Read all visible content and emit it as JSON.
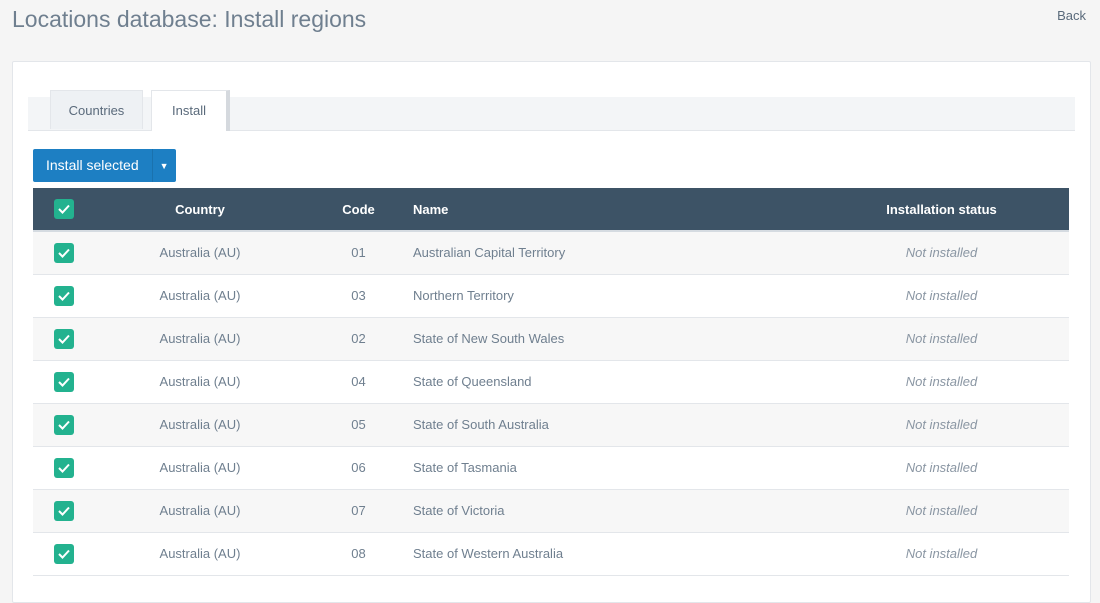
{
  "page": {
    "title": "Locations database: Install regions",
    "back_label": "Back"
  },
  "tabs": [
    {
      "label": "Countries",
      "active": false
    },
    {
      "label": "Install",
      "active": true
    }
  ],
  "toolbar": {
    "install_selected_label": "Install selected"
  },
  "table": {
    "columns": [
      "Country",
      "Code",
      "Name",
      "Installation status"
    ],
    "rows": [
      {
        "checked": true,
        "country": "Australia (AU)",
        "code": "01",
        "name": "Australian Capital Territory",
        "status": "Not installed"
      },
      {
        "checked": true,
        "country": "Australia (AU)",
        "code": "03",
        "name": "Northern Territory",
        "status": "Not installed"
      },
      {
        "checked": true,
        "country": "Australia (AU)",
        "code": "02",
        "name": "State of New South Wales",
        "status": "Not installed"
      },
      {
        "checked": true,
        "country": "Australia (AU)",
        "code": "04",
        "name": "State of Queensland",
        "status": "Not installed"
      },
      {
        "checked": true,
        "country": "Australia (AU)",
        "code": "05",
        "name": "State of South Australia",
        "status": "Not installed"
      },
      {
        "checked": true,
        "country": "Australia (AU)",
        "code": "06",
        "name": "State of Tasmania",
        "status": "Not installed"
      },
      {
        "checked": true,
        "country": "Australia (AU)",
        "code": "07",
        "name": "State of Victoria",
        "status": "Not installed"
      },
      {
        "checked": true,
        "country": "Australia (AU)",
        "code": "08",
        "name": "State of Western Australia",
        "status": "Not installed"
      }
    ]
  },
  "colors": {
    "header_bg": "#3d5366",
    "accent_button": "#1d7fc3",
    "checkbox": "#23b28f"
  }
}
